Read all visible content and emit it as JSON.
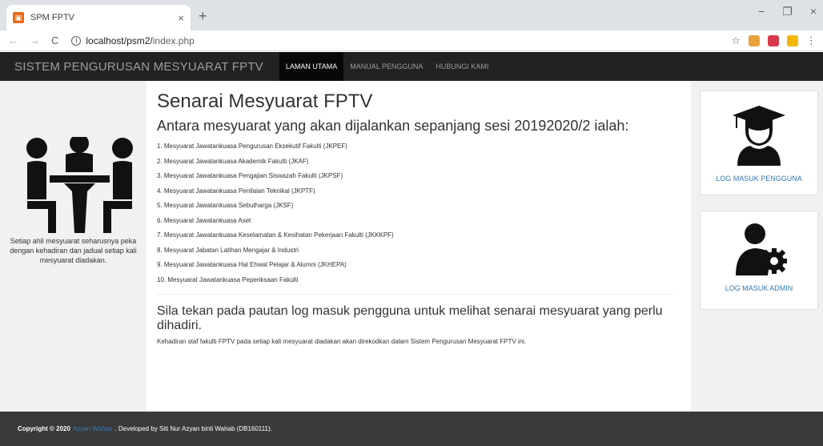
{
  "browser": {
    "tab_title": "SPM FPTV",
    "tab_close": "×",
    "new_tab": "+",
    "url_host": "localhost/psm2/",
    "url_path": "index.php",
    "win_min": "−",
    "win_max": "❐",
    "win_close": "×"
  },
  "navbar": {
    "brand": "SISTEM PENGURUSAN MESYUARAT FPTV",
    "links": [
      "LAMAN UTAMA",
      "MANUAL PENGGUNA",
      "HUBUNGI KAMI"
    ],
    "active_index": 0
  },
  "left": {
    "note": "Setiap ahli mesyuarat seharusnya peka dengan kehadiran dan jadual setiap kali mesyuarat diadakan."
  },
  "main": {
    "title": "Senarai Mesyuarat FPTV",
    "subtitle": "Antara mesyuarat yang akan dijalankan sepanjang sesi 20192020/2 ialah:",
    "meetings": [
      "1. Mesyuarat Jawatankuasa Pengurusan Eksekutif Fakulti (JKPEF)",
      "2. Mesyuarat Jawatankuasa Akademik Fakulti (JKAF)",
      "3. Mesyuarat Jawatankuasa Pengajian Siswazah Fakulti (JKPSF)",
      "4. Mesyuarat Jawatankuasa Penilaian Teknikal (JKPTF)",
      "5. Mesyuarat Jawatankuasa Sebutharga (JKSF)",
      "6. Mesyuarat Jawatankuasa Aset",
      "7. Mesyuarat Jawatankuasa Keselamatan & Kesihatan Pekerjaan Fakulti (JKKKPF)",
      "8. Mesyuarat Jabatan Latihan Mengajar & Industri",
      "9. Mesyuarat Jawatankuasa Hal Ehwal Pelajar & Alumni (JKHEPA)",
      "10. Mesyuarat Jawatankuasa Peperiksaan Fakulti"
    ],
    "heading2": "Sila tekan pada pautan log masuk pengguna untuk melihat senarai mesyuarat yang perlu dihadiri.",
    "note": "Kehadiran staf fakulti FPTV pada setiap kali mesyuarat diadakan akan direkodkan dalam Sistem Pengurusan Mesyuarat FPTV ini."
  },
  "right": {
    "user_login": "LOG MASUK PENGGUNA",
    "admin_login": "LOG MASUK ADMIN"
  },
  "footer": {
    "copyright": "Copyright © 2020",
    "author_link": "Azyan Wahab",
    "developed": ". Developed by Siti Nur Azyan binti Wahab (DB160111)."
  },
  "icons": {
    "meeting": "meeting-people-icon",
    "user": "graduate-user-icon",
    "admin": "admin-gear-icon"
  }
}
